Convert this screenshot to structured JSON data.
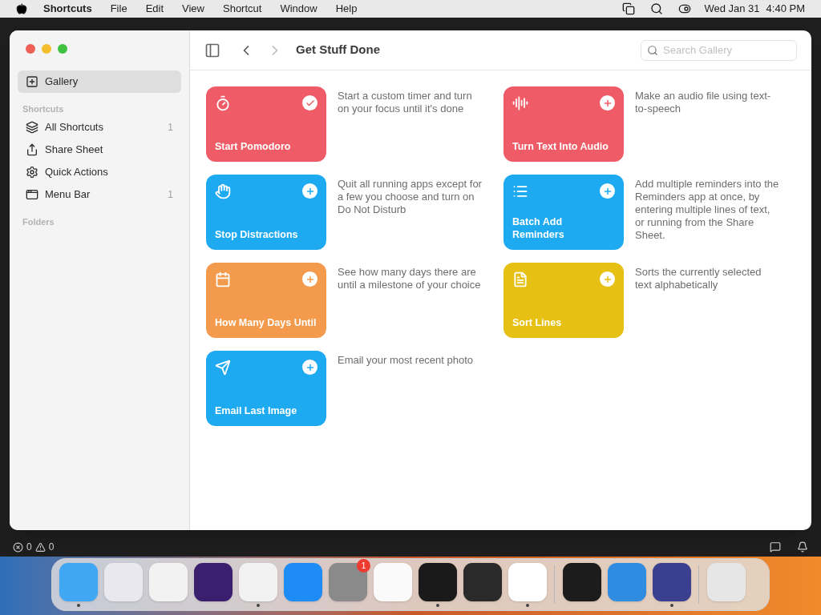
{
  "menu_bar": {
    "app": "Shortcuts",
    "menus": [
      "File",
      "Edit",
      "View",
      "Shortcut",
      "Window",
      "Help"
    ],
    "date": "Wed Jan 31",
    "time": "4:40 PM"
  },
  "sidebar": {
    "top": {
      "label": "Gallery",
      "selected": true
    },
    "sections": [
      {
        "title": "Shortcuts",
        "items": [
          {
            "label": "All Shortcuts",
            "count": "1",
            "selected": false
          },
          {
            "label": "Share Sheet",
            "selected": false
          },
          {
            "label": "Quick Actions",
            "selected": false
          },
          {
            "label": "Menu Bar",
            "count": "1",
            "selected": false
          }
        ]
      },
      {
        "title": "Folders"
      }
    ]
  },
  "toolbar": {
    "title": "Get Stuff Done",
    "search": {
      "placeholder": "Search Gallery"
    }
  },
  "gallery": [
    {
      "name": "Start Pomodoro",
      "description": "Start a custom timer and turn on your focus until it's done",
      "color": "#ef5b66",
      "added": true
    },
    {
      "name": "Turn Text Into Audio",
      "description": "Make an audio file using text-to-speech",
      "color": "#ef5b66",
      "added": false
    },
    {
      "name": "Stop Distractions",
      "description": "Quit all running apps except for a few you choose and turn on Do Not Disturb",
      "color": "#1eaaf1",
      "added": false
    },
    {
      "name": "Batch Add Reminders",
      "description": "Add multiple reminders into the Reminders app at once, by entering multiple lines of text, or running from the Share Sheet.",
      "color": "#1eaaf1",
      "added": false
    },
    {
      "name": "How Many Days Until",
      "description": "See how many days there are until a milestone of your choice",
      "color": "#f39a4c",
      "added": false
    },
    {
      "name": "Sort Lines",
      "description": "Sorts the currently selected text alphabetically",
      "color": "#e6c012",
      "added": false
    },
    {
      "name": "Email Last Image",
      "description": "Email your most recent photo",
      "color": "#1eaaf1",
      "added": false
    }
  ],
  "status_bar": {
    "errors": "0",
    "warnings": "0"
  },
  "dock": [
    {
      "running": true
    },
    {
      "running": false
    },
    {
      "running": false
    },
    {
      "running": false
    },
    {
      "running": true
    },
    {
      "running": false
    },
    {
      "running": false,
      "badge": "1"
    },
    {
      "running": false
    },
    {
      "running": true
    },
    {
      "running": false
    },
    {
      "running": true
    },
    {
      "running": false
    },
    {
      "running": false
    },
    {
      "running": true
    },
    {
      "running": false
    }
  ]
}
